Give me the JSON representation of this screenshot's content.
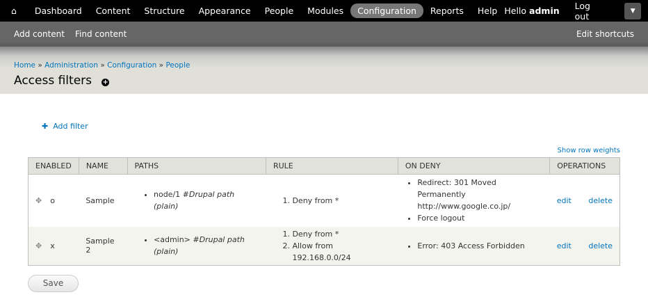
{
  "toolbar": {
    "items": [
      "Dashboard",
      "Content",
      "Structure",
      "Appearance",
      "People",
      "Modules",
      "Configuration",
      "Reports",
      "Help"
    ],
    "hello": "Hello",
    "user": "admin",
    "logout": "Log out"
  },
  "shortcuts": {
    "add": "Add content",
    "find": "Find content",
    "edit": "Edit shortcuts"
  },
  "breadcrumb": [
    "Home",
    "Administration",
    "Configuration",
    "People"
  ],
  "title": "Access filters",
  "add_filter": "Add filter",
  "show_weights": "Show row weights",
  "table": {
    "headers": [
      "ENABLED",
      "NAME",
      "PATHS",
      "RULE",
      "ON DENY",
      "OPERATIONS"
    ],
    "rows": [
      {
        "enabled": "o",
        "name": "Sample",
        "path": "node/1",
        "path_note": "#Drupal path (plain)",
        "rules": [
          "Deny from *"
        ],
        "deny": [
          "Redirect: 301 Moved Permanently http://www.google.co.jp/",
          "Force logout"
        ]
      },
      {
        "enabled": "x",
        "name": "Sample 2",
        "path": "<admin>",
        "path_note": "#Drupal path (plain)",
        "rules": [
          "Deny from *",
          "Allow from 192.168.0.0/24"
        ],
        "deny": [
          "Error: 403 Access Forbidden"
        ]
      }
    ],
    "edit": "edit",
    "delete": "delete"
  },
  "save": "Save"
}
